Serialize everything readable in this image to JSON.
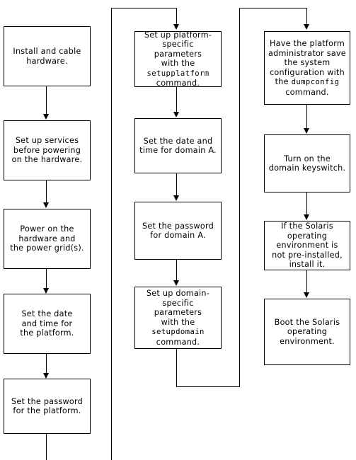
{
  "diagram": {
    "title": "Sun platform and domain setup flowchart",
    "line_color": "#000000",
    "box_fill": "#ffffff",
    "background": "#ffffff"
  },
  "columns": [
    {
      "id": "column-1",
      "name": "platform-setup-column",
      "nodes": [
        {
          "id": "n1",
          "text": "Install and cable\nhardware."
        },
        {
          "id": "n2",
          "text": "Set up services\nbefore powering\non the hardware."
        },
        {
          "id": "n3",
          "text": "Power on the\nhardware and\nthe power grid(s)."
        },
        {
          "id": "n4",
          "text": "Set the date\nand time for\nthe  platform."
        },
        {
          "id": "n5",
          "text": "Set the password\nfor the  platform."
        }
      ]
    },
    {
      "id": "column-2",
      "name": "domain-setup-column",
      "nodes": [
        {
          "id": "n6",
          "text_before": "Set up platform-\nspecific  parameters\nwith  the",
          "command": "setupplatform",
          "text_after": "command."
        },
        {
          "id": "n7",
          "text": "Set the date and\ntime for domain A."
        },
        {
          "id": "n8",
          "text": "Set the password\nfor domain A."
        },
        {
          "id": "n9",
          "text_before": "Set up domain-\nspecific  parameters\nwith the",
          "command": "setupdomain",
          "text_after": "command."
        }
      ]
    },
    {
      "id": "column-3",
      "name": "solaris-boot-column",
      "nodes": [
        {
          "id": "n10",
          "text_before": "Have the platform\nadministrator save\nthe  system\nconfiguration with\nthe",
          "command": "dumpconfig",
          "text_after": "command."
        },
        {
          "id": "n11",
          "text": "Turn on the\ndomain keyswitch."
        },
        {
          "id": "n12",
          "text": "If the Solaris\noperating\nenvironment is\nnot pre-installed,\ninstall it."
        },
        {
          "id": "n13",
          "text": "Boot the Solaris\noperating\nenvironment."
        }
      ]
    }
  ]
}
